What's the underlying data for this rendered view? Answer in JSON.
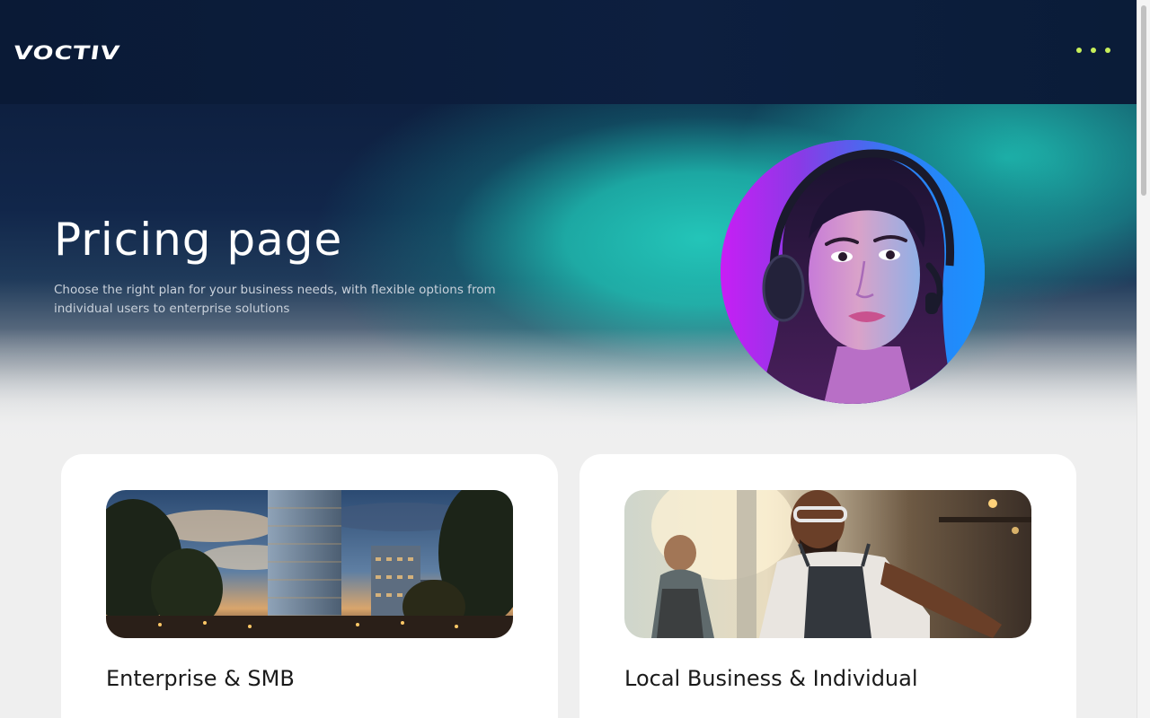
{
  "header": {
    "logo_text": "VOCTIV",
    "menu_icon": "more-dots-icon",
    "accent_color": "#c7ef5a",
    "background_color": "#0d1f3f"
  },
  "hero": {
    "title": "Pricing page",
    "subtitle": "Choose the right plan for your business needs, with flexible options from individual users to enterprise solutions",
    "image": "customer-support-agent-headset-photo"
  },
  "cards": [
    {
      "title": "Enterprise & SMB",
      "image": "city-office-towers-dusk-photo"
    },
    {
      "title": "Local Business & Individual",
      "image": "barista-working-cafe-photo"
    }
  ],
  "colors": {
    "teal_glow": "#24cdbe",
    "card_background": "#ffffff",
    "page_background": "#efefef"
  }
}
